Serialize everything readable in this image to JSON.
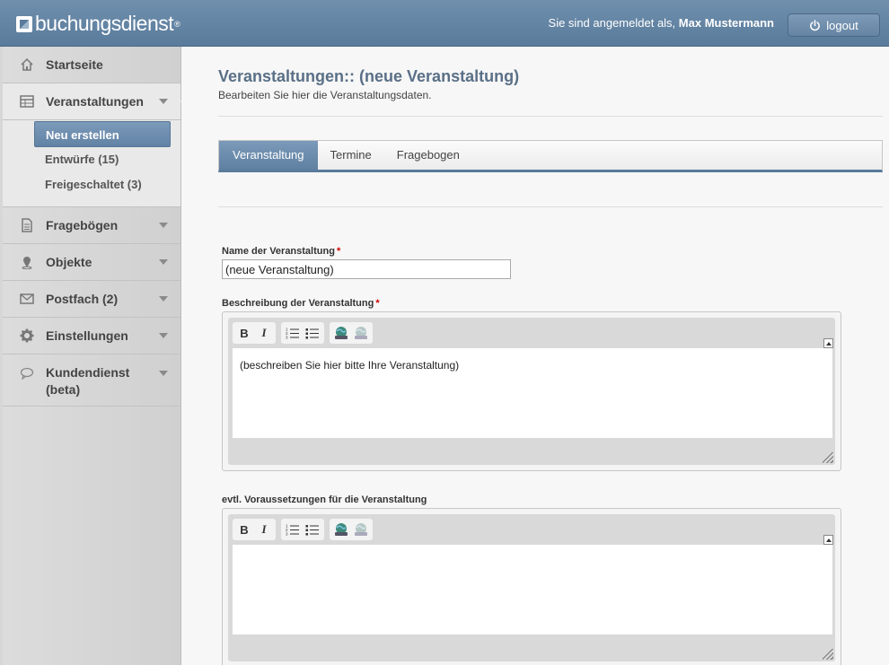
{
  "header": {
    "brand": "buchungsdienst",
    "brand_mark": "®",
    "login_prefix": "Sie sind angemeldet als, ",
    "user_name": "Max Mustermann",
    "logout_label": "logout",
    "logout_icon": "power-icon"
  },
  "sidebar": {
    "items": [
      {
        "label": "Startseite",
        "icon": "home-icon"
      },
      {
        "label": "Veranstaltungen",
        "icon": "calendar-table-icon"
      },
      {
        "label": "Fragebögen",
        "icon": "document-icon"
      },
      {
        "label": "Objekte",
        "icon": "map-pin-icon"
      },
      {
        "label": "Postfach (2)",
        "icon": "envelope-icon"
      },
      {
        "label": "Einstellungen",
        "icon": "gear-icon"
      },
      {
        "label": "Kundendienst",
        "label2": "(beta)",
        "icon": "speech-bubble-icon"
      }
    ],
    "subitems": [
      {
        "label": "Neu erstellen"
      },
      {
        "label": "Entwürfe (15)"
      },
      {
        "label": "Freigeschaltet (3)"
      }
    ]
  },
  "main": {
    "title": "Veranstaltungen:: (neue Veranstaltung)",
    "subtitle": "Bearbeiten Sie hier die Veranstaltungsdaten.",
    "tabs": [
      {
        "label": "Veranstaltung"
      },
      {
        "label": "Termine"
      },
      {
        "label": "Fragebogen"
      }
    ],
    "form": {
      "name_label": "Name der Veranstaltung",
      "name_value": "(neue Veranstaltung)",
      "required_mark": "*",
      "description_label": "Beschreibung der Veranstaltung",
      "description_value": "(beschreiben Sie hier bitte Ihre Veranstaltung)",
      "prerequisites_label": "evtl. Voraussetzungen für die Veranstaltung",
      "prerequisites_value": ""
    },
    "editor_tools": {
      "bold": "B",
      "italic": "I"
    }
  },
  "colors": {
    "accent": "#5a7b9b",
    "header_bg": "#6f8fad",
    "title": "#5a7087",
    "required": "#cc0000"
  }
}
